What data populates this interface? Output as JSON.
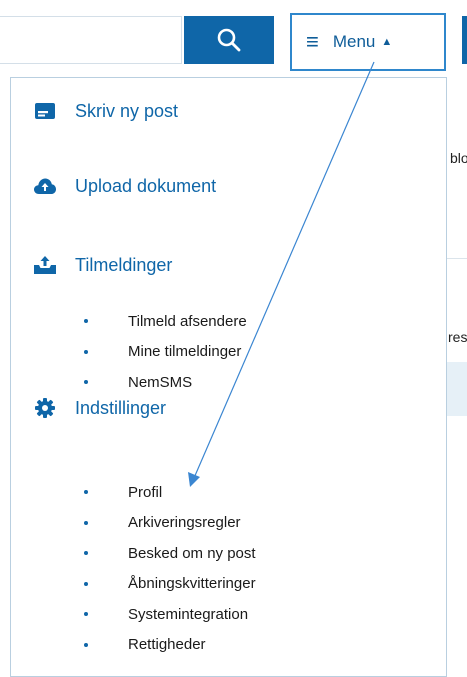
{
  "header": {
    "search_button_icon": "search-icon",
    "menu_icon": "hamburger-icon",
    "menu_label": "Menu",
    "menu_caret": "▲"
  },
  "background": {
    "fragment_1": "blo",
    "fragment_2": "res"
  },
  "menu": {
    "items": [
      {
        "label": "Skriv ny post",
        "icon": "compose-icon"
      },
      {
        "label": "Upload dokument",
        "icon": "cloud-upload-icon"
      },
      {
        "label": "Tilmeldinger",
        "icon": "inbox-upload-icon",
        "subitems": [
          "Tilmeld afsendere",
          "Mine tilmeldinger",
          "NemSMS"
        ]
      },
      {
        "label": "Indstillinger",
        "icon": "gear-icon",
        "subitems": [
          "Profil",
          "Arkiveringsregler",
          "Besked om ny post",
          "Åbningskvitteringer",
          "Systemintegration",
          "Rettigheder"
        ]
      }
    ]
  },
  "colors": {
    "brand_blue": "#0f66a8",
    "annotation_arrow": "#3b86d1"
  }
}
